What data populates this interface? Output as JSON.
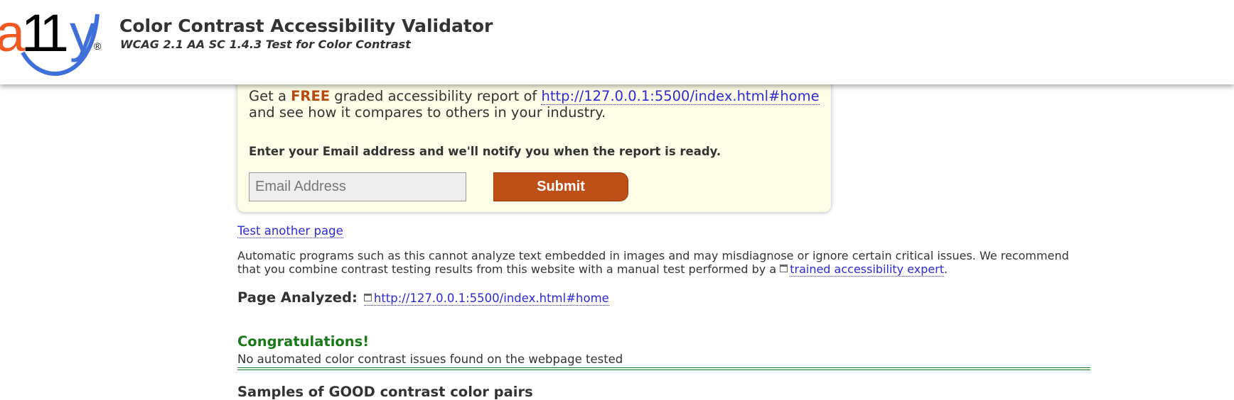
{
  "header": {
    "logo_text": "a11y",
    "logo_mark": "®",
    "title": "Color Contrast Accessibility Validator",
    "subtitle": "WCAG 2.1 AA SC 1.4.3 Test for Color Contrast"
  },
  "promo": {
    "line1_prefix": "Get a ",
    "line1_free": "FREE",
    "line1_middle": " graded accessibility report of ",
    "report_url": "http://127.0.0.1:5500/index.html#home",
    "line2": "and see how it compares to others in your industry.",
    "notify_text": "Enter your Email address and we'll notify you when the report is ready.",
    "email_placeholder": "Email Address",
    "email_value": "",
    "submit_label": "Submit"
  },
  "test_another_link": "Test another page",
  "disclaimer": {
    "text": "Automatic programs such as this cannot analyze text embedded in images and may misdiagnose or ignore certain critical issues. We recommend that you combine contrast testing results from this website with a manual test performed by a ",
    "expert_link": "trained accessibility expert",
    "end": "."
  },
  "analyzed": {
    "label": "Page Analyzed:",
    "url": "http://127.0.0.1:5500/index.html#home"
  },
  "result": {
    "heading": "Congratulations!",
    "message": "No automated color contrast issues found on the webpage tested"
  },
  "samples_heading": "Samples of GOOD contrast color pairs",
  "icons": {
    "external": "external-link-icon"
  },
  "colors": {
    "logo_orange": "#f05a22",
    "logo_blue": "#3f6fd8",
    "accent": "#bd4f17",
    "link": "#2a2ad6",
    "success": "#1a7a1a",
    "promo_bg": "#fefee8"
  }
}
